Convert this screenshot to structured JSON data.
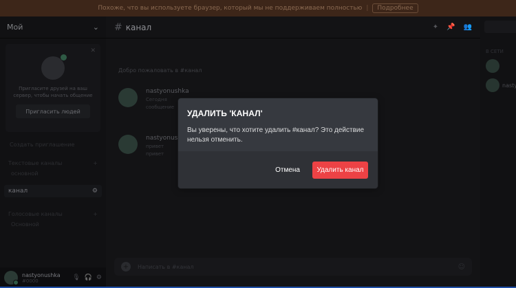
{
  "banner": {
    "text": "Похоже, что вы используете браузер, который мы не поддерживаем полностью",
    "cta": "Подробнее"
  },
  "server": {
    "name": "Мой",
    "chevron": "chevron-down"
  },
  "invite_card": {
    "text": "Пригласите друзей на ваш сервер, чтобы начать общение",
    "button": "Пригласить людей"
  },
  "sidebar": {
    "link": "Создать приглашение",
    "categories": [
      {
        "label": "Текстовые каналы",
        "channels": [
          "основной"
        ]
      },
      {
        "label": "Голосовые каналы",
        "channels": [
          "Основной"
        ]
      }
    ],
    "active_channel": "канал"
  },
  "user": {
    "name": "nastyonushka",
    "tag": "#0000"
  },
  "chat": {
    "hash": "#",
    "title": "канал",
    "welcome": "Добро пожаловать в #канал",
    "messages": [
      {
        "author": "nastyonushka",
        "lines": [
          "Сегодня",
          "сообщение"
        ]
      },
      {
        "author": "nastyonushka",
        "lines": [
          "привет",
          "привет"
        ]
      }
    ],
    "composer_placeholder": "Написать в #канал"
  },
  "members": {
    "heading": "В СЕТИ"
  },
  "modal": {
    "title": "УДАЛИТЬ 'КАНАЛ'",
    "body": "Вы уверены, что хотите удалить #канал? Это действие нельзя отменить.",
    "cancel_label": "Отмена",
    "delete_label": "Удалить канал"
  },
  "colors": {
    "danger": "#ed4245",
    "modal_bg": "#36393f",
    "modal_footer": "#2f3136",
    "banner": "#3d2619"
  }
}
